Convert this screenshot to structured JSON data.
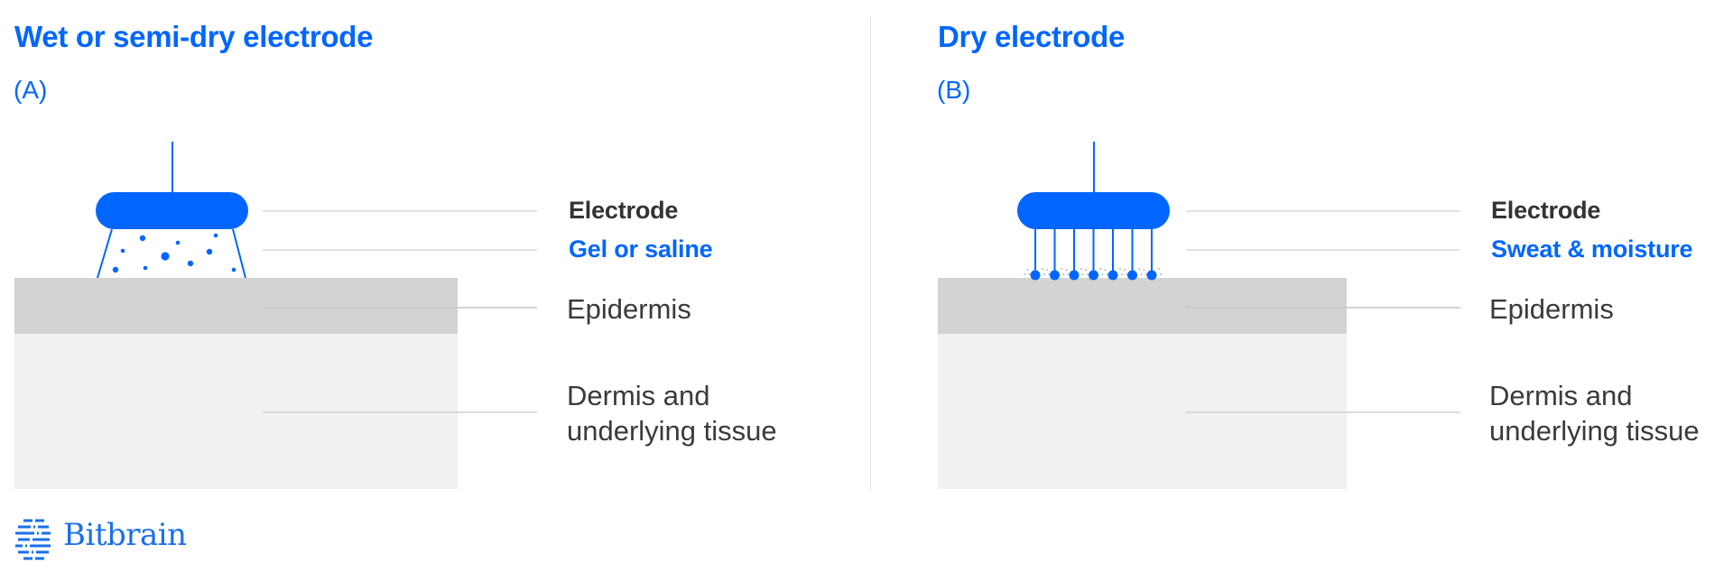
{
  "colors": {
    "accent": "#0066FF",
    "epidermis": "#d3d3d3",
    "dermis": "#f1f1f1",
    "leader": "#dcdcdc",
    "label_dark": "#333333",
    "label_light": "#3a3a3a"
  },
  "panels": [
    {
      "title": "Wet or semi-dry electrode",
      "tag": "(A)",
      "labels": {
        "electrode": "Electrode",
        "interface": "Gel or saline",
        "epidermis": "Epidermis",
        "dermis_line1": "Dermis and",
        "dermis_line2": "underlying tissue"
      },
      "interface_type": "gel"
    },
    {
      "title": "Dry electrode",
      "tag": "(B)",
      "labels": {
        "electrode": "Electrode",
        "interface": "Sweat & moisture",
        "epidermis": "Epidermis",
        "dermis_line1": "Dermis and",
        "dermis_line2": "underlying tissue"
      },
      "interface_type": "pins",
      "pin_count": 7
    }
  ],
  "brand": {
    "icon": "bitbrain-logo-icon",
    "name": "Bitbrain"
  }
}
